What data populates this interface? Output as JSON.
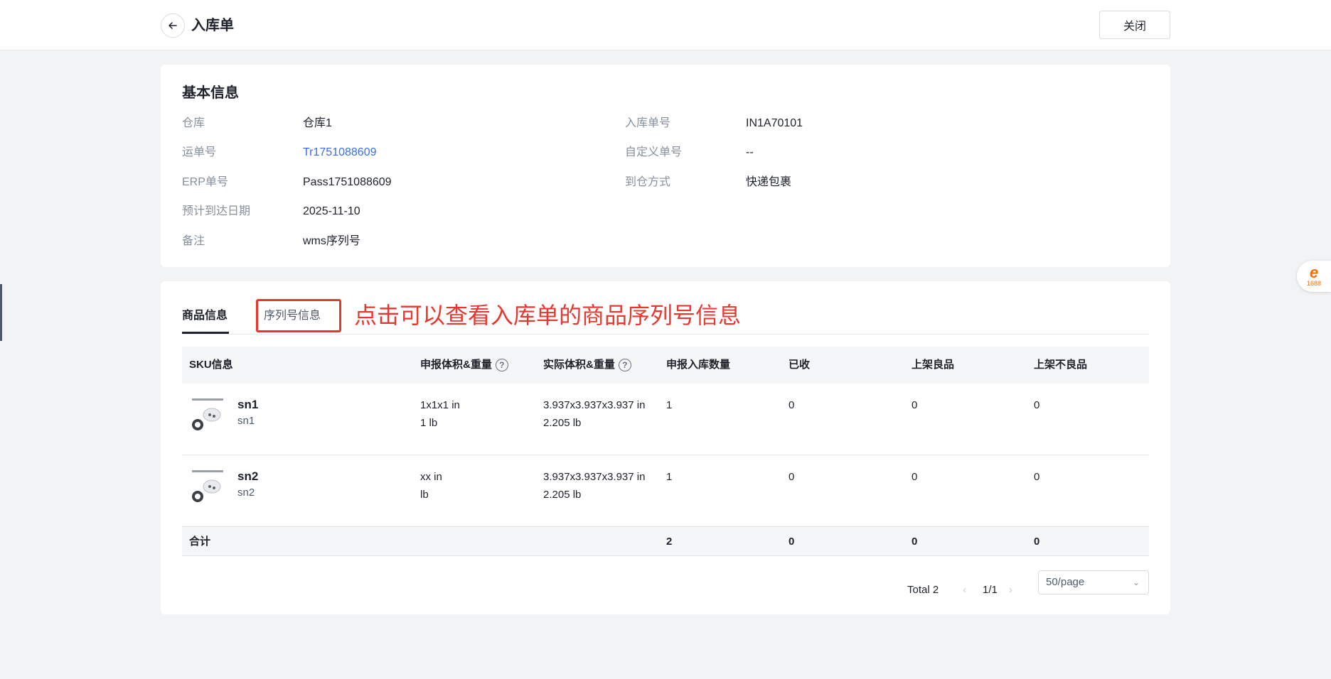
{
  "header": {
    "title": "入库单",
    "close_label": "关闭"
  },
  "basic_info": {
    "title": "基本信息",
    "warehouse_label": "仓库",
    "warehouse_value": "仓库1",
    "tracking_label": "运单号",
    "tracking_value": "Tr1751088609",
    "erp_label": "ERP单号",
    "erp_value": "Pass1751088609",
    "eta_label": "预计到达日期",
    "eta_value": "2025-11-10",
    "remark_label": "备注",
    "remark_value": "wms序列号",
    "inbound_no_label": "入库单号",
    "inbound_no_value": "IN1A70101",
    "custom_no_label": "自定义单号",
    "custom_no_value": "--",
    "arrival_method_label": "到仓方式",
    "arrival_method_value": "快递包裹"
  },
  "tabs": {
    "goods": "商品信息",
    "serial": "序列号信息"
  },
  "annotation": "点击可以查看入库单的商品序列号信息",
  "table": {
    "headers": {
      "sku": "SKU信息",
      "declared": "申报体积&重量",
      "actual": "实际体积&重量",
      "declared_qty": "申报入库数量",
      "received": "已收",
      "good": "上架良品",
      "defective": "上架不良品"
    },
    "help_icon": "question-circle-icon",
    "rows": [
      {
        "sku_code": "sn1",
        "sku_name": "sn1",
        "declared_size": "1x1x1 in",
        "declared_weight": "1 lb",
        "actual_size": "3.937x3.937x3.937 in",
        "actual_weight": "2.205 lb",
        "declared_qty": "1",
        "received": "0",
        "good": "0",
        "defective": "0"
      },
      {
        "sku_code": "sn2",
        "sku_name": "sn2",
        "declared_size": "xx in",
        "declared_weight": "lb",
        "actual_size": "3.937x3.937x3.937 in",
        "actual_weight": "2.205 lb",
        "declared_qty": "1",
        "received": "0",
        "good": "0",
        "defective": "0"
      }
    ],
    "footer": {
      "label": "合计",
      "declared_qty": "2",
      "received": "0",
      "good": "0",
      "defective": "0"
    }
  },
  "pagination": {
    "total": "Total 2",
    "prev": "‹",
    "page": "1/1",
    "next": "›",
    "page_size": "50/page"
  },
  "side_badge": {
    "logo": "e",
    "number": "1688"
  },
  "colors": {
    "accent": "#3a6ee8",
    "annotation": "#e8372f",
    "brand_1688": "#ff6a00"
  }
}
